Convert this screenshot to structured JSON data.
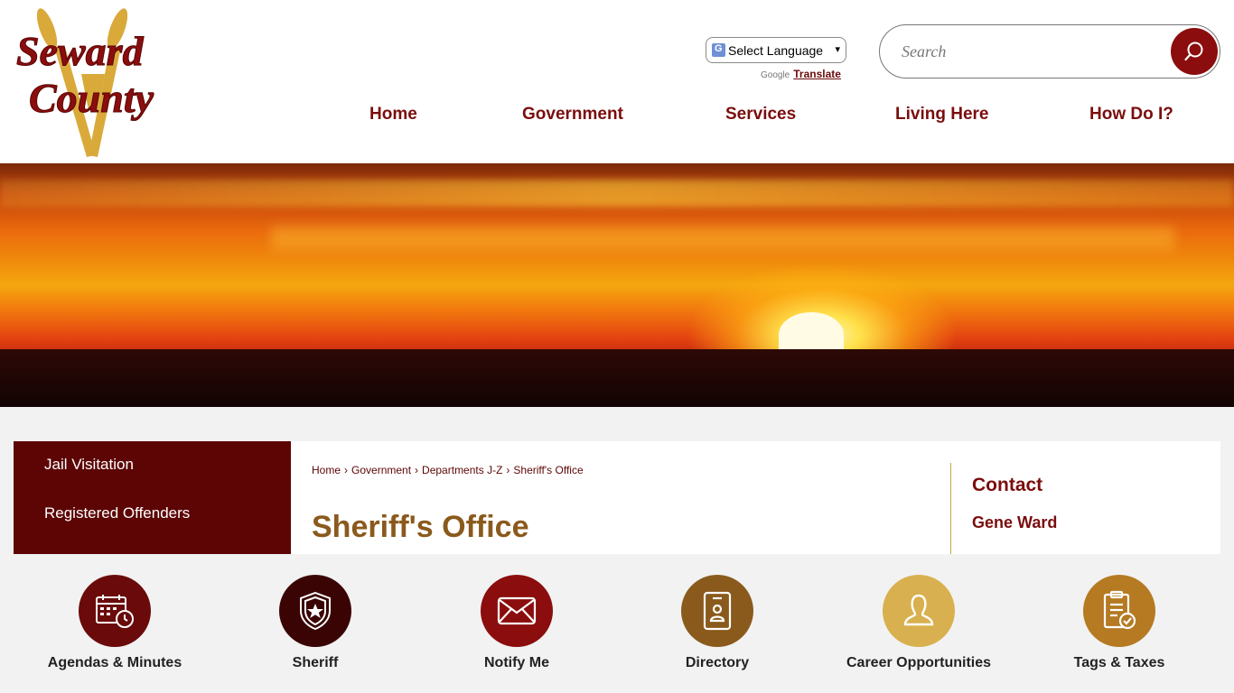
{
  "header": {
    "logo_text": "Seward County",
    "language_select": "Select Language",
    "powered_by": "Google",
    "translate_label": "Translate",
    "search_placeholder": "Search"
  },
  "nav": {
    "items": [
      {
        "label": "Home"
      },
      {
        "label": "Government"
      },
      {
        "label": "Services"
      },
      {
        "label": "Living Here"
      },
      {
        "label": "How Do I?"
      }
    ]
  },
  "sidebar": {
    "items": [
      {
        "label": "Jail Visitation"
      },
      {
        "label": "Registered Offenders"
      }
    ]
  },
  "breadcrumb": [
    "Home",
    "Government",
    "Departments J-Z",
    "Sheriff's Office"
  ],
  "breadcrumb_sep": "›",
  "page_title": "Sheriff's Office",
  "contact": {
    "heading": "Contact",
    "name": "Gene Ward"
  },
  "quick_links": [
    {
      "label": "Agendas & Minutes",
      "icon": "calendar-clock-icon",
      "color": "#6a0a0a"
    },
    {
      "label": "Sheriff",
      "icon": "sheriff-badge-icon",
      "color": "#3a0404"
    },
    {
      "label": "Notify Me",
      "icon": "envelope-icon",
      "color": "#8b0d0d"
    },
    {
      "label": "Directory",
      "icon": "directory-icon",
      "color": "#8a5a1c"
    },
    {
      "label": "Career Opportunities",
      "icon": "person-icon",
      "color": "#d9b04f"
    },
    {
      "label": "Tags & Taxes",
      "icon": "clipboard-check-icon",
      "color": "#b57a22"
    }
  ],
  "colors": {
    "brand_maroon": "#7a0d0d",
    "sidebar_bg": "#5d0505",
    "title_gold": "#8a5a1c"
  }
}
